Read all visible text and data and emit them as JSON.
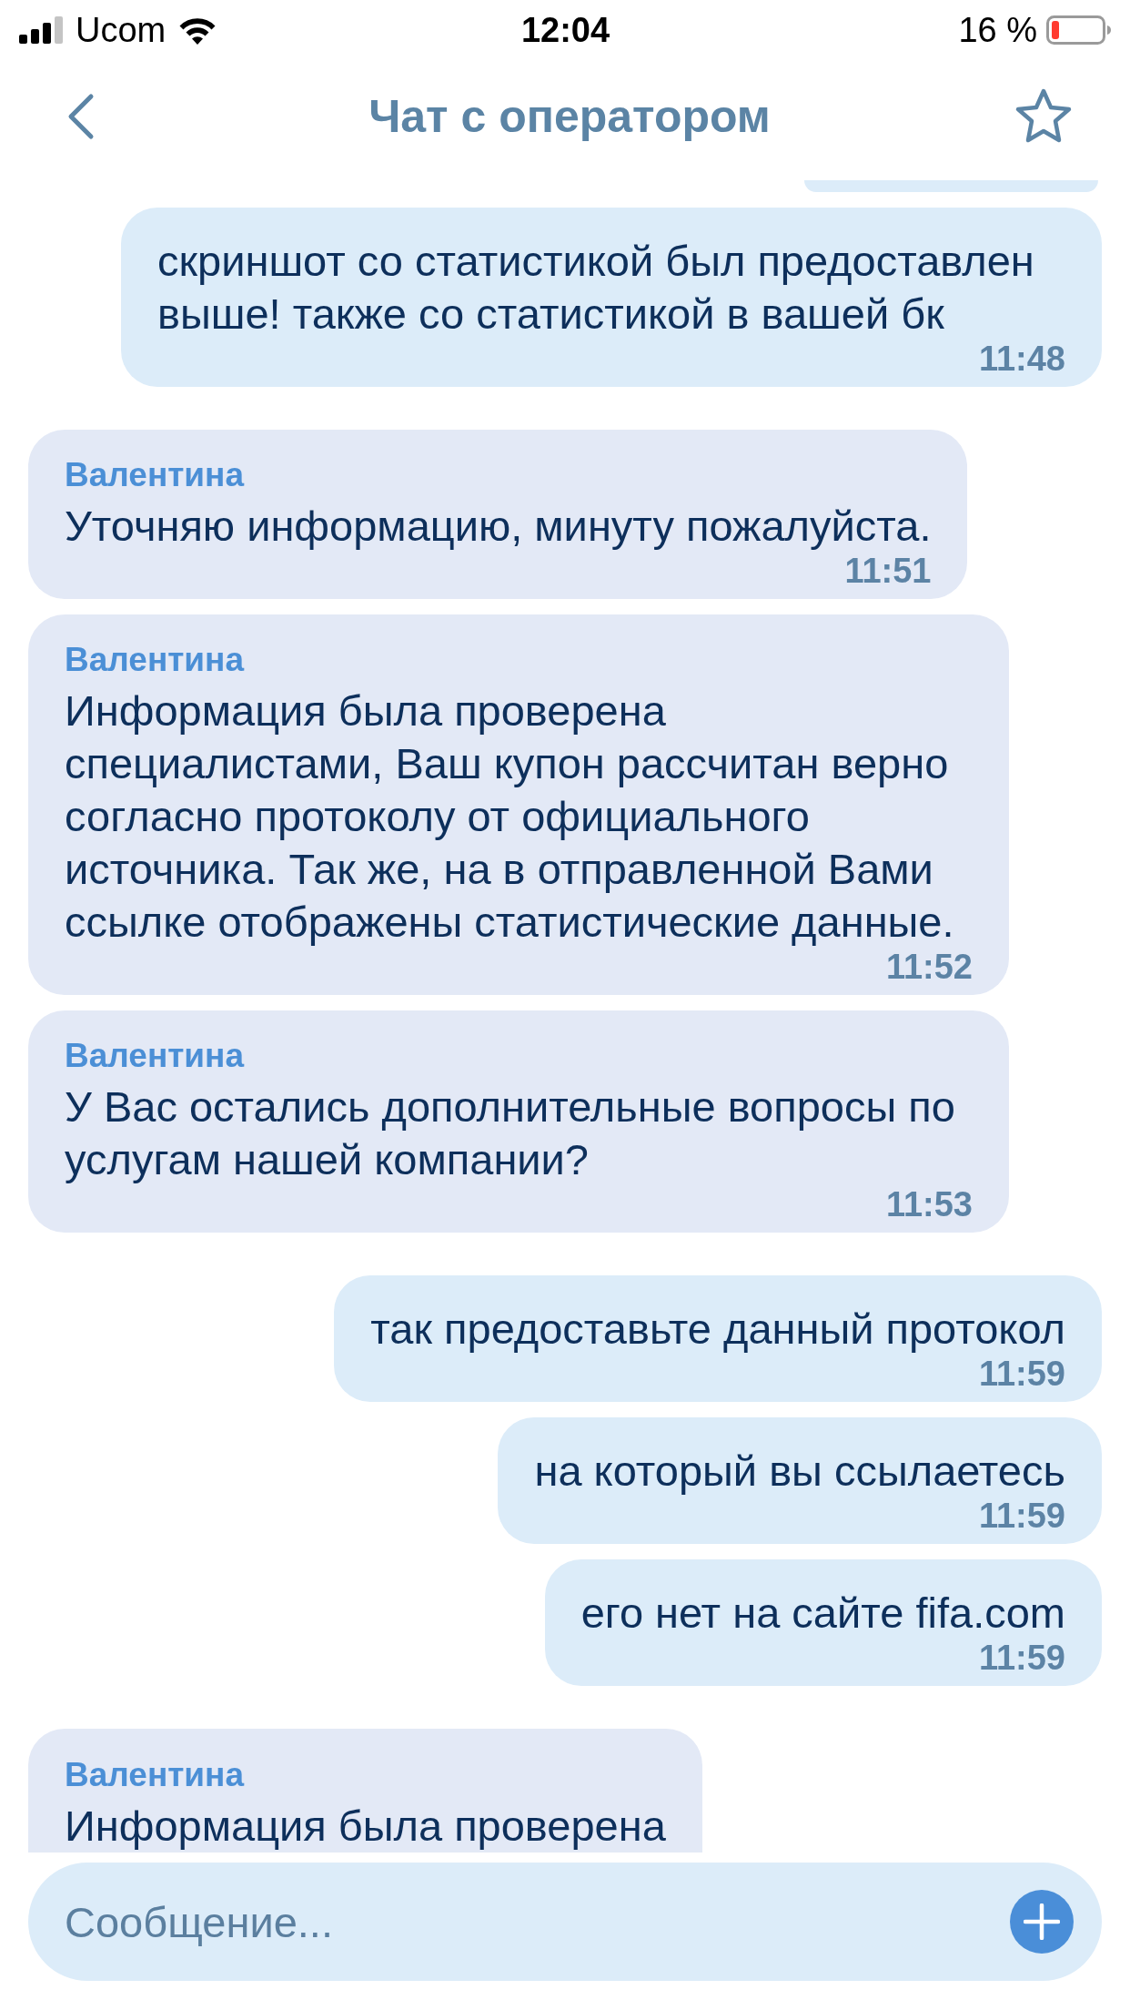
{
  "status_bar": {
    "carrier": "Ucom",
    "time": "12:04",
    "battery": "16 %"
  },
  "header": {
    "title": "Чат с оператором"
  },
  "messages": [
    {
      "kind": "outgoing"
    },
    {
      "kind": "outgoing",
      "text": "скриншот со статистикой был предоставлен\nвыше! также со статистикой в вашей бк",
      "time": "11:48"
    },
    {
      "kind": "incoming",
      "sender": "Валентина",
      "text": "Уточняю информацию, минуту пожалуйста.",
      "time": "11:51"
    },
    {
      "kind": "incoming",
      "sender": "Валентина",
      "text": "Информация была проверена\nспециалистами, Ваш купон рассчитан верно\nсогласно протоколу от официального\nисточника. Так же, на в отправленной Вами\nссылке отображены статистические данные.",
      "time": "11:52"
    },
    {
      "kind": "incoming",
      "sender": "Валентина",
      "text": "У Вас остались дополнительные вопросы по\nуслугам нашей компании?",
      "time": "11:53"
    },
    {
      "kind": "outgoing",
      "text": "так предоставьте данный протокол",
      "time": "11:59"
    },
    {
      "kind": "outgoing",
      "text": "на который вы ссылаетесь",
      "time": "11:59"
    },
    {
      "kind": "outgoing",
      "text": "его нет на сайте fifa.com",
      "time": "11:59"
    },
    {
      "kind": "incoming",
      "sender": "Валентина",
      "text": "Информация была проверена"
    }
  ],
  "composer": {
    "placeholder": "Сообщение..."
  }
}
